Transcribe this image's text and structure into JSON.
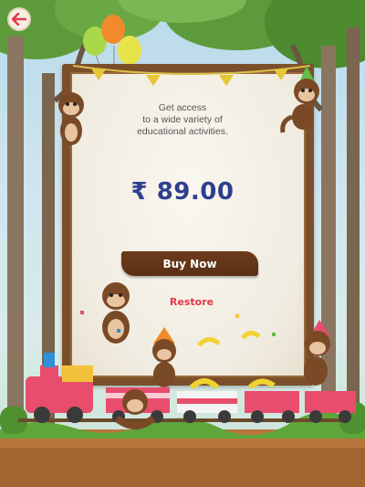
{
  "purchase": {
    "headline_lines": [
      "Get access",
      "to a wide variety of",
      "educational activities."
    ],
    "price": "₹ 89.00",
    "buy_label": "Buy Now",
    "restore_label": "Restore"
  },
  "icons": {
    "back": "back-arrow-icon"
  },
  "colors": {
    "price": "#2e3f8f",
    "buy_button": "#5e3217",
    "restore": "#e2394a",
    "board_frame": "#7a4f2a"
  }
}
